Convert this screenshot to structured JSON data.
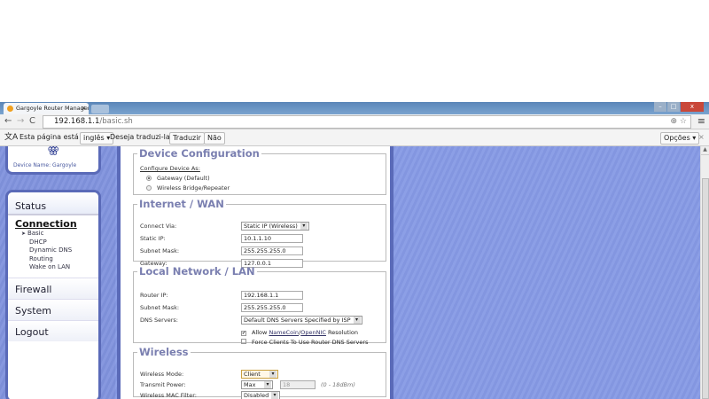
{
  "browser": {
    "tab_title": "Gargoyle Router Managem",
    "url_host": "192.168.1.1",
    "url_path": "/basic.sh"
  },
  "translate_bar": {
    "text1": "Esta página está em",
    "language": "inglês",
    "text2": "Deseja traduzi-la?",
    "translate_button": "Traduzir",
    "no_button": "Não",
    "options_button": "Opções"
  },
  "sidebar": {
    "device_name": "Device Name: Gargoyle",
    "status": "Status",
    "section": "Connection",
    "sub_items": [
      "Basic",
      "DHCP",
      "Dynamic DNS",
      "Routing",
      "Wake on LAN"
    ],
    "items": [
      "Firewall",
      "System",
      "Logout"
    ]
  },
  "device_config": {
    "title": "Device Configuration",
    "configure_as": "Configure Device As:",
    "options": [
      "Gateway (Default)",
      "Wireless Bridge/Repeater"
    ]
  },
  "wan": {
    "title": "Internet / WAN",
    "connect_via_label": "Connect Via:",
    "connect_via": "Static IP (Wireless)",
    "static_ip_label": "Static IP:",
    "static_ip": "10.1.1.10",
    "subnet_label": "Subnet Mask:",
    "subnet": "255.255.255.0",
    "gateway_label": "Gateway:",
    "gateway": "127.0.0.1"
  },
  "lan": {
    "title": "Local Network / LAN",
    "router_ip_label": "Router IP:",
    "router_ip": "192.168.1.1",
    "subnet_label": "Subnet Mask:",
    "subnet": "255.255.255.0",
    "dns_label": "DNS Servers:",
    "dns": "Default DNS Servers Specified by ISP",
    "allow_pre": "Allow",
    "namecoin": "NameCoin",
    "slash": "/",
    "opennic": "OpenNIC",
    "allow_post": "Resolution",
    "force_clients": "Force Clients To Use Router DNS Servers"
  },
  "wireless": {
    "title": "Wireless",
    "mode_label": "Wireless Mode:",
    "mode": "Client",
    "power_label": "Transmit Power:",
    "power": "Max",
    "power_value": "18",
    "power_range": "(0 - 18dBm)",
    "mac_label": "Wireless MAC Filter:",
    "mac": "Disabled"
  }
}
